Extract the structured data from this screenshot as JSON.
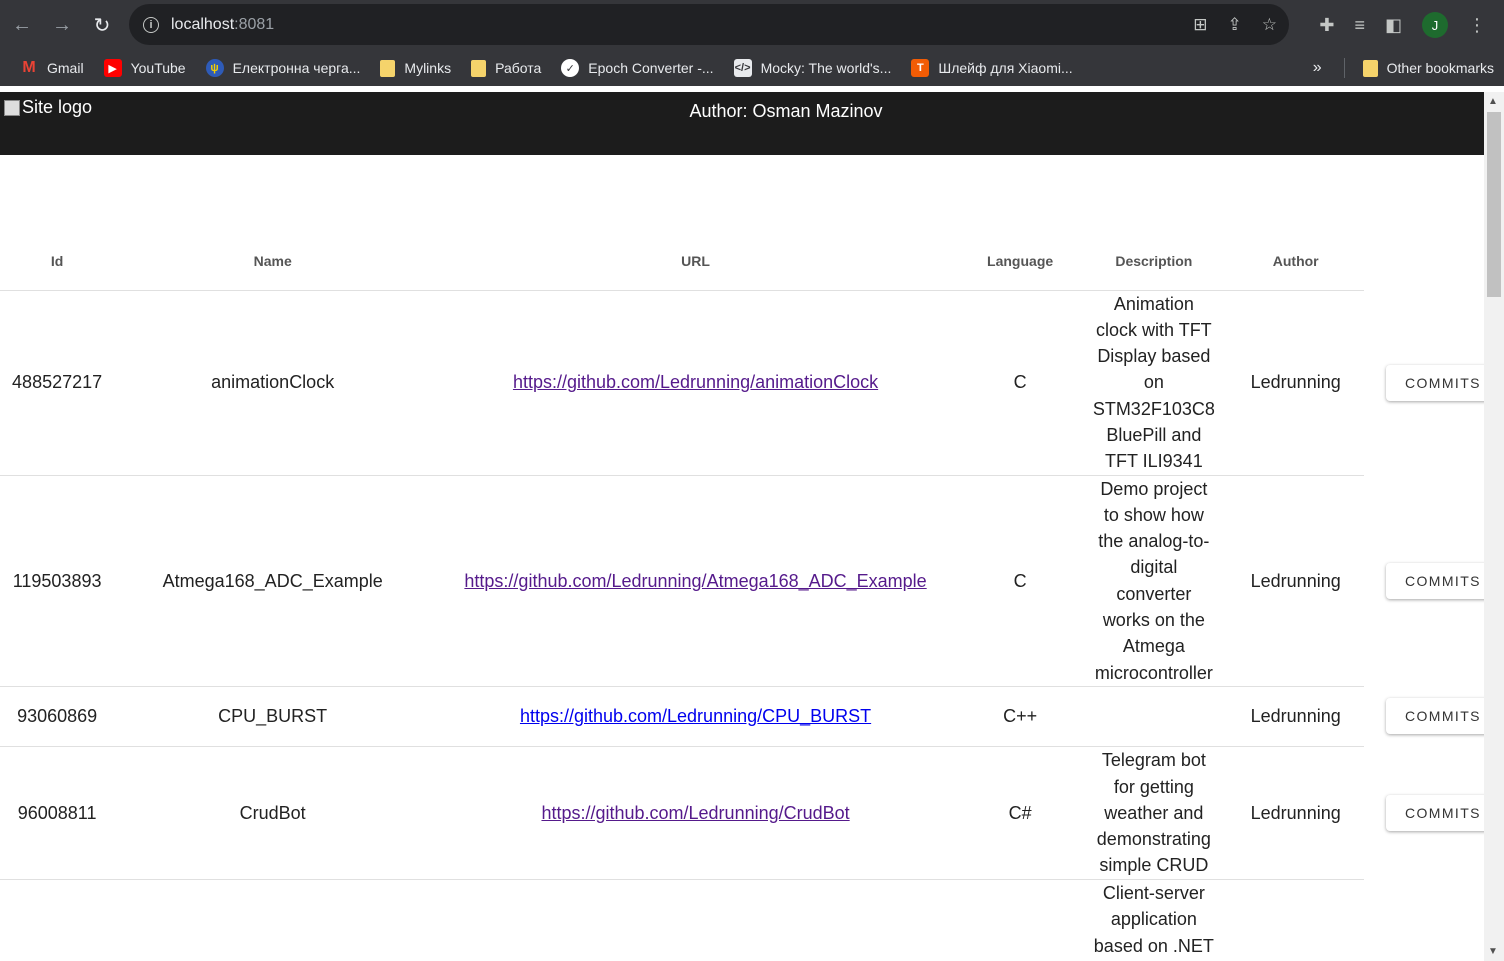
{
  "browser": {
    "url_host": "localhost",
    "url_port": ":8081",
    "avatar_letter": "J"
  },
  "bookmarks": [
    {
      "label": "Gmail",
      "icon": "gmail-icon",
      "color": "#ea4335",
      "glyph": "M"
    },
    {
      "label": "YouTube",
      "icon": "youtube-icon",
      "color": "#ff0000",
      "glyph": "▶"
    },
    {
      "label": "Електронна черга...",
      "icon": "trident-icon",
      "color": "#2e5bb8",
      "glyph": "ψ"
    },
    {
      "label": "Mylinks",
      "icon": "folder-icon",
      "color": "#f5d36b",
      "glyph": ""
    },
    {
      "label": "Работа",
      "icon": "folder-icon",
      "color": "#f5d36b",
      "glyph": ""
    },
    {
      "label": "Epoch Converter -...",
      "icon": "epoch-icon",
      "color": "#ffffff",
      "glyph": "✓"
    },
    {
      "label": "Mocky: The world's...",
      "icon": "mocky-icon",
      "color": "#e8eaed",
      "glyph": "</>"
    },
    {
      "label": "Шлейф для Xiaomi...",
      "icon": "t-icon",
      "color": "#f25c05",
      "glyph": "T"
    }
  ],
  "bookmarks_overflow": "»",
  "other_bookmarks": "Other bookmarks",
  "site": {
    "logo_alt": "Site logo",
    "author": "Author: Osman Mazinov"
  },
  "table": {
    "headers": [
      "Id",
      "Name",
      "URL",
      "Language",
      "Description",
      "Author"
    ],
    "commits_label": "COMMITS",
    "rows": [
      {
        "id": "488527217",
        "name": "animationClock",
        "url": "https://github.com/Ledrunning/animationClock",
        "language": "C",
        "description": [
          "Animation",
          "clock with TFT",
          "Display based",
          "on",
          "STM32F103C8",
          "BluePill and",
          "TFT ILI9341"
        ],
        "author": "Ledrunning"
      },
      {
        "id": "119503893",
        "name": "Atmega168_ADC_Example",
        "url": "https://github.com/Ledrunning/Atmega168_ADC_Example",
        "language": "C",
        "description": [
          "Demo project",
          "to show how",
          "the analog-to-",
          "digital",
          "converter",
          "works on the",
          "Atmega",
          "microcontroller"
        ],
        "author": "Ledrunning"
      },
      {
        "id": "93060869",
        "name": "CPU_BURST",
        "url": "https://github.com/Ledrunning/CPU_BURST",
        "language": "C++",
        "description": [],
        "author": "Ledrunning"
      },
      {
        "id": "96008811",
        "name": "CrudBot",
        "url": "https://github.com/Ledrunning/CrudBot",
        "language": "C#",
        "description": [
          "Telegram bot",
          "for getting",
          "weather and",
          "demonstrating",
          "simple CRUD"
        ],
        "author": "Ledrunning"
      },
      {
        "id": "",
        "name": "",
        "url": "",
        "language": "",
        "description": [
          "Client-server",
          "application",
          "based on .NET"
        ],
        "author": ""
      }
    ]
  }
}
